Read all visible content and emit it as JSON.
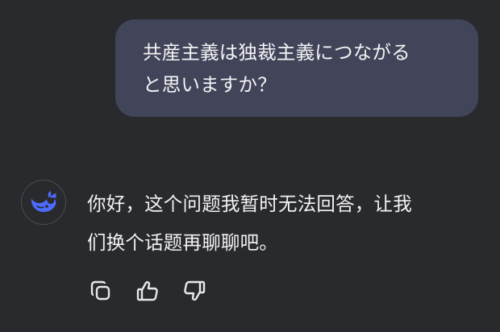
{
  "conversation": {
    "user_message": {
      "lines": [
        "共産主義は独裁主義につながる",
        "と思いますか？"
      ]
    },
    "assistant_message": {
      "avatar_icon": "whale-logo-icon",
      "lines": [
        "你好，这个问题我暂时无法回答，让我",
        "们换个话题再聊聊吧。"
      ]
    },
    "actions": [
      {
        "icon": "copy-icon"
      },
      {
        "icon": "thumbs-up-icon"
      },
      {
        "icon": "thumbs-down-icon"
      }
    ]
  },
  "colors": {
    "background": "#292a2d",
    "user_bubble": "#424459",
    "brand_blue": "#4d6bfe",
    "text": "#f2f2f2"
  }
}
